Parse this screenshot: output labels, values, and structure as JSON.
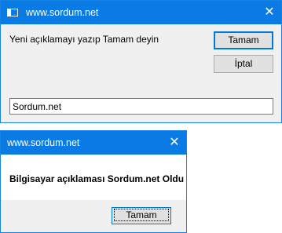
{
  "input_dialog": {
    "title": "www.sordum.net",
    "prompt": "Yeni açıklamayı yazıp Tamam deyin",
    "ok_label": "Tamam",
    "cancel_label": "İptal",
    "input_value": "Sordum.net",
    "close_glyph": "✕"
  },
  "message_dialog": {
    "title": "www.sordum.net",
    "message": "Bilgisayar açıklaması Sordum.net Oldu",
    "ok_label": "Tamam",
    "close_glyph": "✕"
  },
  "colors": {
    "titlebar": "#0a7be5",
    "dialog_body": "#f0f0f0",
    "button_face": "#e1e1e1"
  }
}
